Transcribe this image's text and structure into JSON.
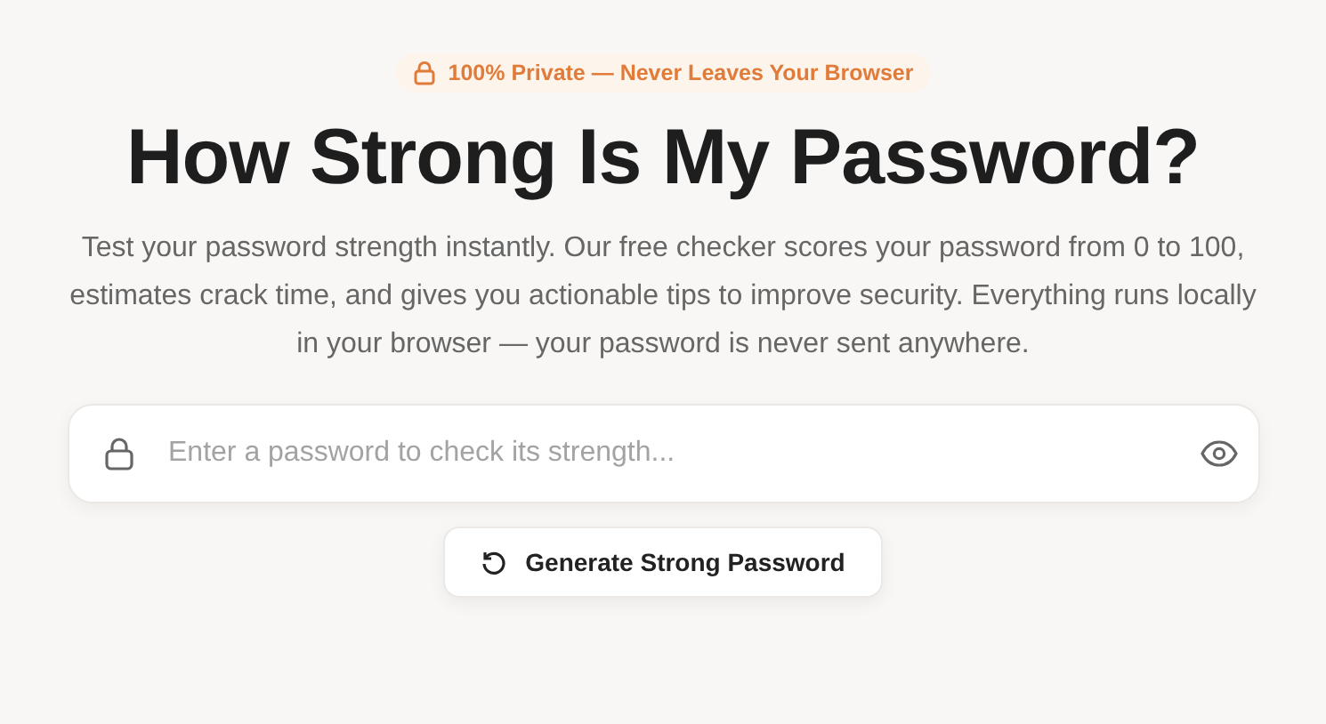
{
  "badge": {
    "text": "100% Private — Never Leaves Your Browser"
  },
  "heading": "How Strong Is My Password?",
  "description": "Test your password strength instantly. Our free checker scores your password from 0 to 100, estimates crack time, and gives you actionable tips to improve security. Everything runs locally in your browser — your password is never sent anywhere.",
  "password_field": {
    "placeholder": "Enter a password to check its strength..."
  },
  "generate_button": {
    "label": "Generate Strong Password"
  }
}
